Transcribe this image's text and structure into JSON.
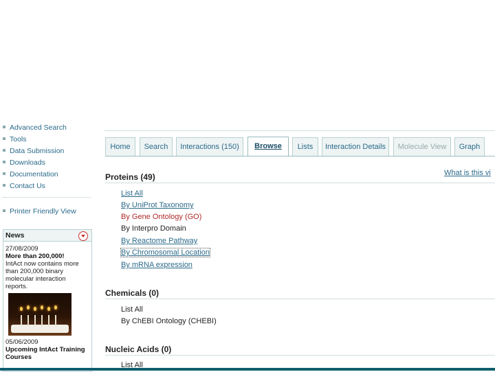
{
  "sidebar": {
    "nav": [
      {
        "label": "Advanced Search"
      },
      {
        "label": "Tools"
      },
      {
        "label": "Data Submission"
      },
      {
        "label": "Downloads"
      },
      {
        "label": "Documentation"
      },
      {
        "label": "Contact Us"
      }
    ],
    "printer_friendly": "Printer Friendly View",
    "news": {
      "header": "News",
      "items": [
        {
          "date": "27/08/2009",
          "title": "More than 200,000!",
          "text": "IntAct now contains more than 200,000 binary molecular interaction reports."
        },
        {
          "date": "05/06/2009",
          "title": "Upcoming IntAct Training Courses",
          "text": ""
        }
      ]
    }
  },
  "tabs": [
    {
      "label": "Home",
      "state": "normal"
    },
    {
      "label": "Search",
      "state": "normal"
    },
    {
      "label": "Interactions (150)",
      "state": "normal"
    },
    {
      "label": "Browse",
      "state": "active"
    },
    {
      "label": "Lists",
      "state": "normal"
    },
    {
      "label": "Interaction Details",
      "state": "normal"
    },
    {
      "label": "Molecule View",
      "state": "disabled"
    },
    {
      "label": "Graph",
      "state": "normal"
    }
  ],
  "proteins": {
    "title": "Proteins (49)",
    "whats_this": "What is this vi",
    "links": [
      "List All",
      "By UniProt Taxonomy",
      "By Gene Ontology (GO)",
      "By Interpro Domain",
      "By Reactome Pathway",
      "By Chromosomal Location",
      "By mRNA expression"
    ]
  },
  "chemicals": {
    "title": "Chemicals (0)",
    "links": [
      "List All",
      "By ChEBI Ontology (CHEBI)"
    ]
  },
  "nucleic_acids": {
    "title": "Nucleic Acids (0)",
    "links": [
      "List All"
    ]
  },
  "colors": {
    "accent": "#2a6a8a",
    "highlight": "#b02a2a",
    "footer": "#0d5d6e"
  }
}
